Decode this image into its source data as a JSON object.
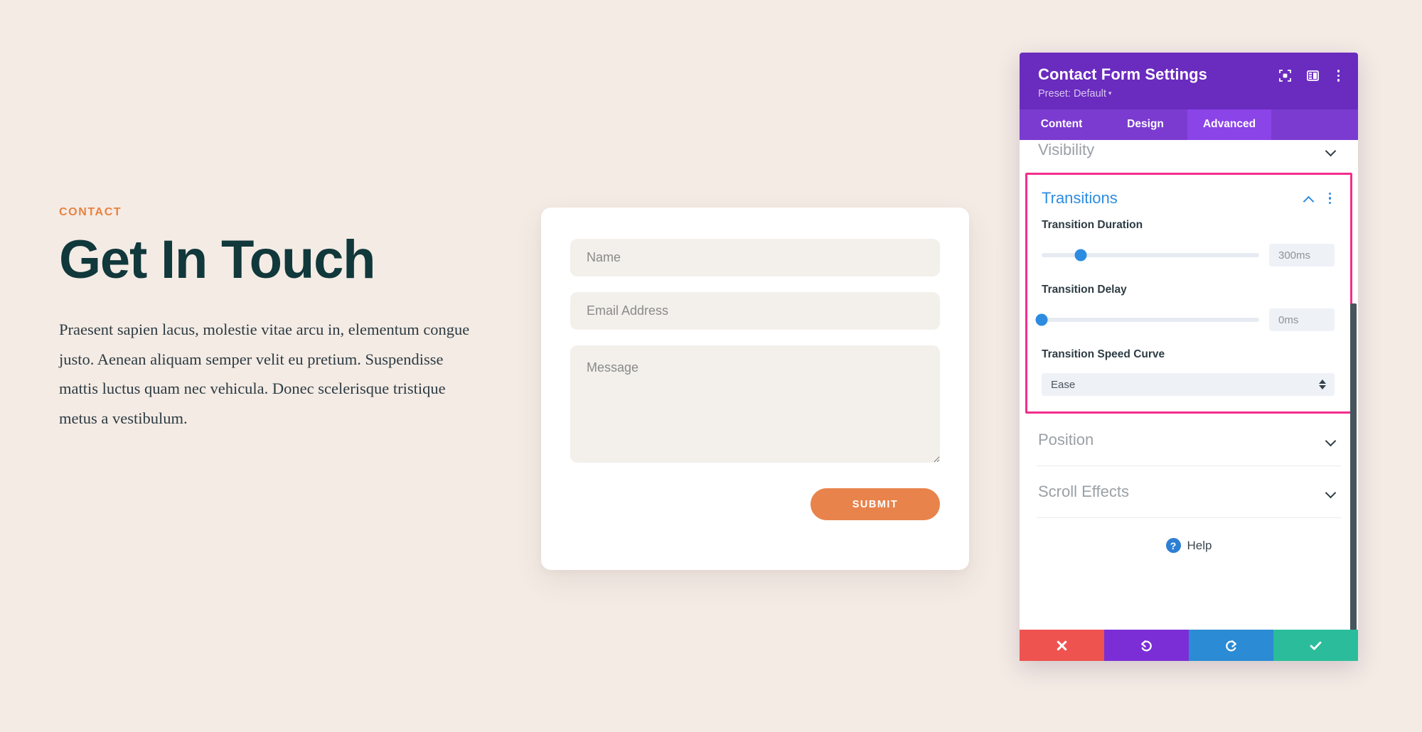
{
  "page": {
    "background_color": "#f4ebe5",
    "eyebrow": "CONTACT",
    "headline": "Get In Touch",
    "paragraph": "Praesent sapien lacus, molestie vitae arcu in, elementum congue justo. Aenean aliquam semper velit eu pretium. Suspendisse mattis luctus quam nec vehicula. Donec scelerisque tristique metus a vestibulum.",
    "accent_color": "#e8823f",
    "heading_color": "#11383b"
  },
  "contact_form": {
    "name_placeholder": "Name",
    "email_placeholder": "Email Address",
    "message_placeholder": "Message",
    "submit_label": "SUBMIT",
    "submit_color": "#e8834c",
    "field_background": "#f3f0eb"
  },
  "settings_panel": {
    "title": "Contact Form Settings",
    "preset_label": "Preset: Default",
    "preset_caret": "▾",
    "header_color": "#6a2bbf",
    "header_icons": [
      {
        "name": "fullscreen-icon"
      },
      {
        "name": "layout-toggle-icon"
      },
      {
        "name": "more-options-icon"
      }
    ],
    "tabs": [
      {
        "label": "Content",
        "active": false
      },
      {
        "label": "Design",
        "active": false
      },
      {
        "label": "Advanced",
        "active": true
      }
    ],
    "sections": [
      {
        "title": "Visibility",
        "state": "collapsed"
      },
      {
        "title": "Position",
        "state": "collapsed"
      },
      {
        "title": "Scroll Effects",
        "state": "collapsed"
      }
    ],
    "transitions": {
      "title": "Transitions",
      "state": "expanded",
      "highlight_color": "#f42d8c",
      "title_color": "#2d8ce0",
      "controls": {
        "duration": {
          "label": "Transition Duration",
          "value": "300ms",
          "slider_percent": 18
        },
        "delay": {
          "label": "Transition Delay",
          "value": "0ms",
          "slider_percent": 0
        },
        "speed_curve": {
          "label": "Transition Speed Curve",
          "value": "Ease"
        }
      }
    },
    "help": {
      "badge": "?",
      "label": "Help"
    },
    "actions": [
      {
        "name": "cancel-button",
        "icon": "close-icon",
        "color": "#ef5350"
      },
      {
        "name": "undo-button",
        "icon": "undo-icon",
        "color": "#7b2ed6"
      },
      {
        "name": "redo-button",
        "icon": "redo-icon",
        "color": "#2b8bd4"
      },
      {
        "name": "save-button",
        "icon": "check-icon",
        "color": "#2bbd9b"
      }
    ]
  }
}
